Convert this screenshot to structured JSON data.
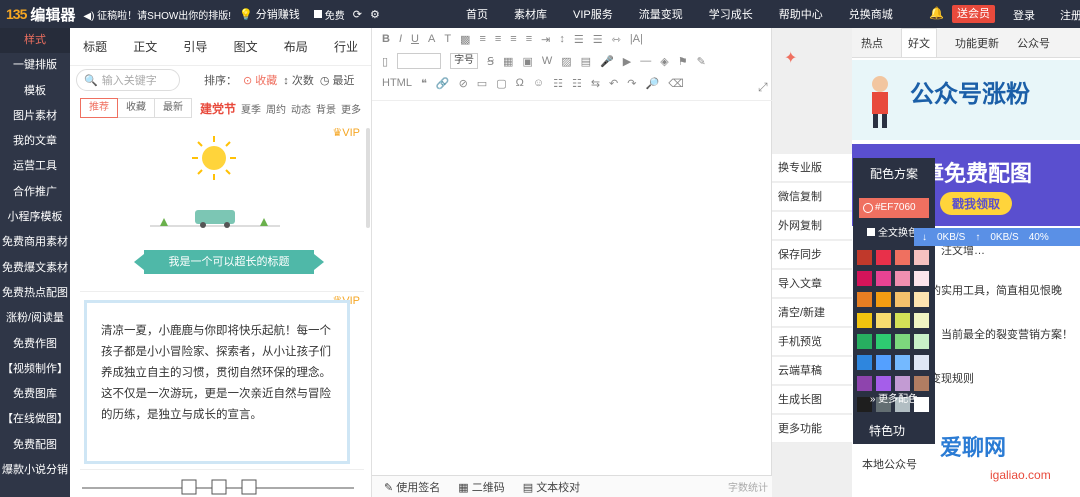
{
  "topbar": {
    "logo_mark": "135",
    "logo_text": "编辑器",
    "announcement": "◀) 征稿啦！请SHOW出你的排版!",
    "fx_label": "分销赚钱",
    "free_label": "免费",
    "nav": [
      "首页",
      "素材库",
      "VIP服务",
      "流量变现",
      "学习成长",
      "帮助中心",
      "兑换商城"
    ],
    "vip_button": "送会员",
    "login": "登录",
    "register": "注册"
  },
  "leftnav": [
    "样式",
    "一键排版",
    "模板",
    "图片素材",
    "我的文章",
    "运营工具",
    "合作推广",
    "小程序模板",
    "免费商用素材",
    "免费爆文素材",
    "免费热点配图",
    "涨粉/阅读量",
    "免费作图",
    "【视频制作】",
    "免费图库",
    "【在线做图】",
    "免费配图",
    "爆款小说分销"
  ],
  "panel": {
    "tabs": [
      "标题",
      "正文",
      "引导",
      "图文",
      "布局",
      "行业"
    ],
    "search_placeholder": "输入关键字",
    "sort_label": "排序：",
    "sort_options": [
      "收藏",
      "次数",
      "最近"
    ],
    "filters": [
      "推荐",
      "收藏",
      "最新"
    ],
    "tags": [
      "建党节",
      "夏季",
      "周约",
      "动态",
      "背景",
      "更多"
    ],
    "vip_badge": "VIP",
    "title_banner": "我是一个可以超长的标题",
    "body_text": "清凉一夏，小鹿鹿与你即将快乐起航！每一个孩子都是小小冒险家、探索者，从小让孩子们养成独立自主的习惯，贯彻自然环保的理念。这不仅是一次游玩，更是一次亲近自然与冒险的历练，是独立与成长的宣言。"
  },
  "editor": {
    "font_size_label": "字号",
    "status": [
      "使用签名",
      "二维码",
      "文本校对"
    ],
    "word_count": "字数统计"
  },
  "actions": [
    "换专业版",
    "微信复制",
    "外网复制",
    "保存同步",
    "导入文章",
    "清空/新建",
    "手机预览",
    "云端草稿",
    "生成长图",
    "更多功能"
  ],
  "rpanel": {
    "tabs": [
      "热点",
      "好文",
      "功能更新",
      "公众号"
    ],
    "banner1_title": "公众号涨粉",
    "banner2_title": "章免费配图",
    "banner2_button": "戳我领取",
    "lines": [
      "，汪文增…",
      "的实用工具，简直相见恨晚",
      "：当前最全的裂变营销方案！",
      "变现规则",
      "本地公众号"
    ]
  },
  "colorpop": {
    "title": "配色方案",
    "current": "#EF7060",
    "all_label": "全文换色",
    "more": "更多配色",
    "special": "特色功"
  },
  "swatches": [
    "#c0392b",
    "#e8304a",
    "#ef7060",
    "#f5c0c0",
    "#d4145a",
    "#e84393",
    "#f08fb0",
    "#fce4ec",
    "#e67e22",
    "#f39c12",
    "#f5c16c",
    "#fde3b0",
    "#f1c40f",
    "#f7dc6f",
    "#d4e157",
    "#f0f4c3",
    "#27ae60",
    "#2ecc71",
    "#7dd87d",
    "#c8f0c8",
    "#2e86de",
    "#54a0ff",
    "#74b9ff",
    "#dfe6f5",
    "#8e44ad",
    "#a55eea",
    "#c39bd3",
    "#b07d62",
    "#1e1e1e",
    "#636e72",
    "#b2bec3",
    "#ffffff"
  ],
  "speed": [
    "0KB/S",
    "0KB/S",
    "40%"
  ],
  "watermark": "爱聊网",
  "watermark_sub": "igaliao.com"
}
